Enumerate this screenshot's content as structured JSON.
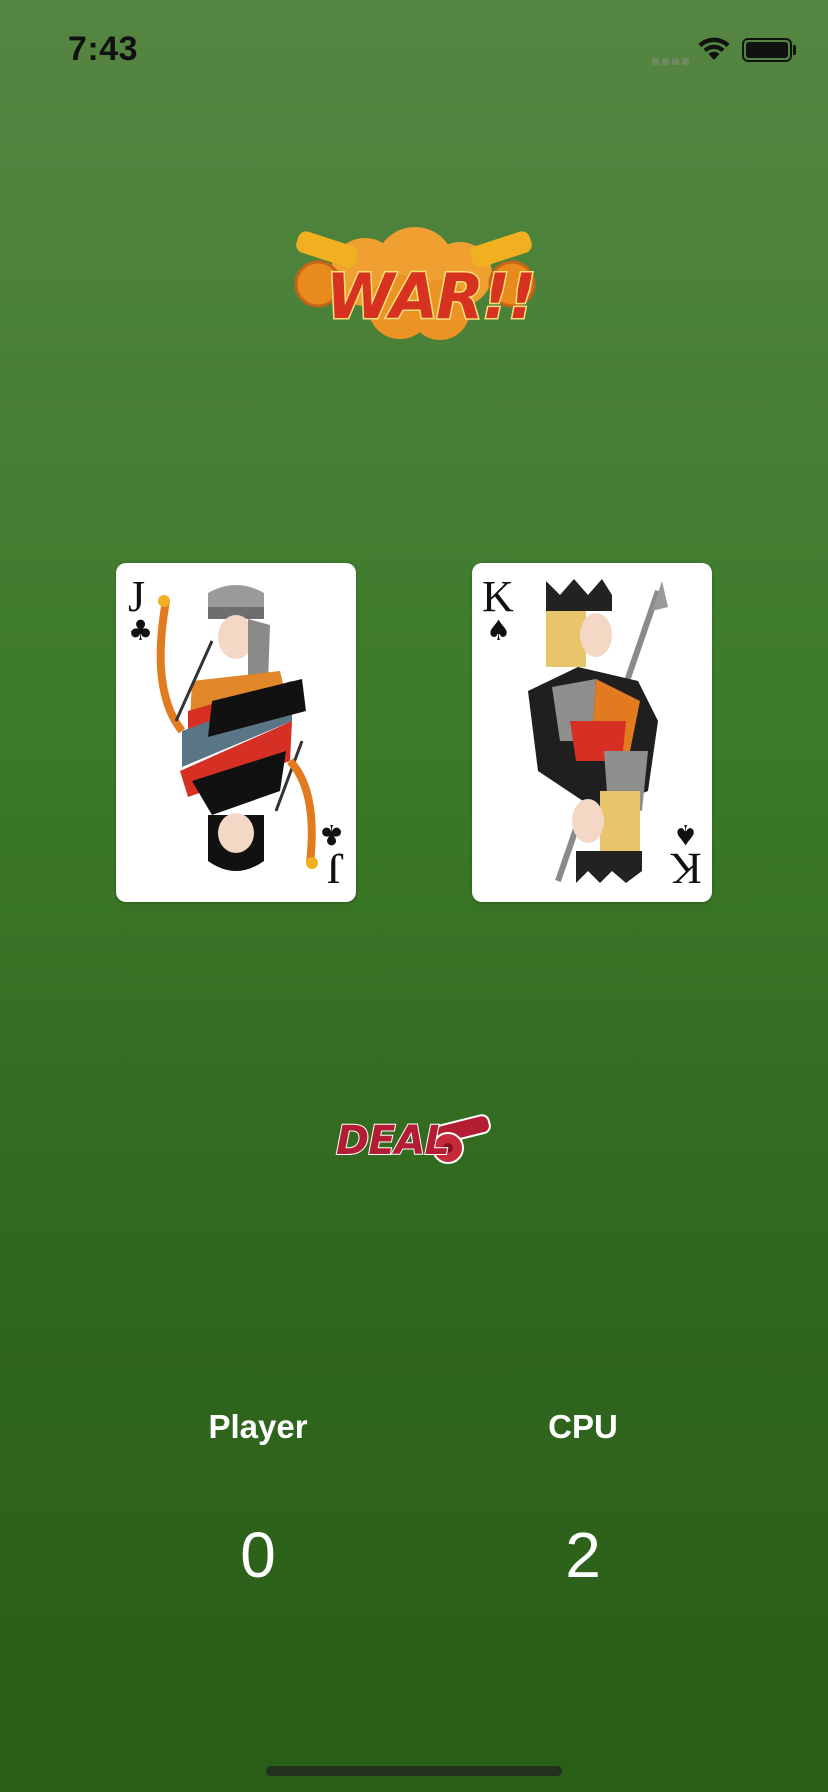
{
  "status_bar": {
    "time": "7:43"
  },
  "logo": {
    "text": "WAR!!"
  },
  "cards": {
    "left": {
      "rank": "J",
      "suit": "♣",
      "suit_name": "clubs",
      "face": "jack"
    },
    "right": {
      "rank": "K",
      "suit": "♠",
      "suit_name": "spades",
      "face": "king"
    }
  },
  "deal_button": {
    "label": "DEAL"
  },
  "scores": {
    "player": {
      "label": "Player",
      "value": "0"
    },
    "cpu": {
      "label": "CPU",
      "value": "2"
    }
  },
  "colors": {
    "background_top": "#558642",
    "background_bottom": "#2a5d16",
    "logo_red": "#d7311f",
    "deal_red": "#b31d33"
  }
}
